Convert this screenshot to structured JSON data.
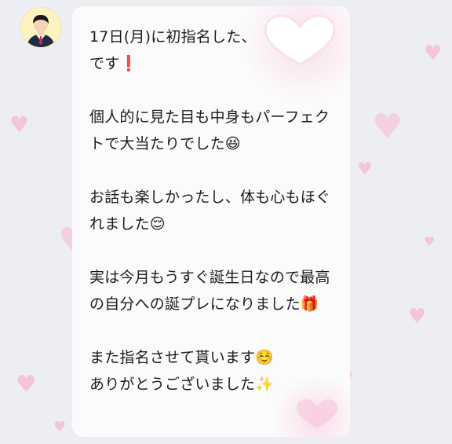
{
  "chat": {
    "message": "17日(月)に初指名した、\nです❗\n\n個人的に見た目も中身もパーフェクトで大当たりでした😆\n\nお話も楽しかったし、体も心もほぐれました😌\n\n実は今月もうすぐ誕生日なので最高の自分への誕プレになりました🎁\n\nまた指名させて貰います☺️\nありがとうございました✨"
  },
  "colors": {
    "background": "#eceef1",
    "bubble": "#fbfbfc",
    "heart": "#f7b8d2",
    "avatar_bg": "#fdf3bf",
    "text": "#1c1c1c"
  },
  "icons": {
    "avatar": "businessman-avatar-icon",
    "background_decoration": "heart-icon"
  }
}
